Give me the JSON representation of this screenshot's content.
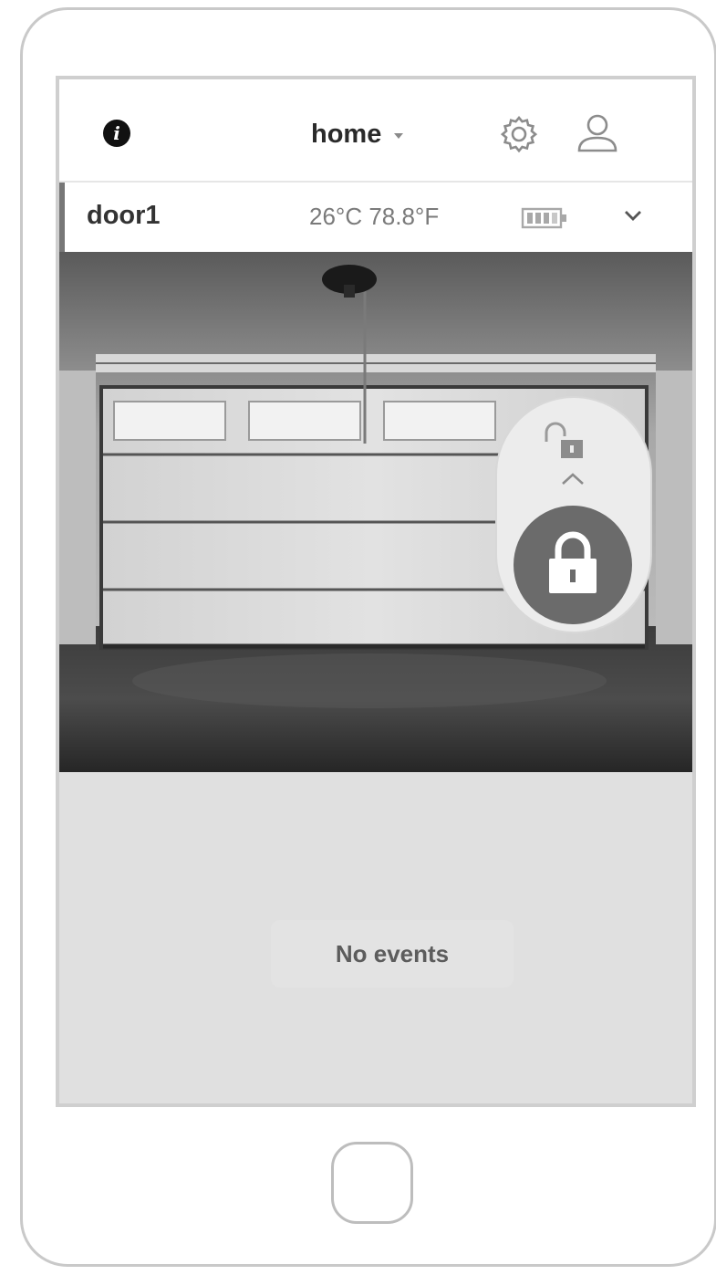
{
  "header": {
    "info_icon": "info-icon",
    "info_glyph": "i",
    "location": "home",
    "settings_icon": "gear-icon",
    "user_icon": "user-icon"
  },
  "device": {
    "name": "door1",
    "temperature": "26°C 78.8°F",
    "battery_icon": "battery-icon",
    "expand_icon": "chevron-down-icon"
  },
  "lock_panel": {
    "unlock_icon": "unlock-icon",
    "swipe_hint_icon": "chevron-up-icon",
    "lock_icon": "lock-icon"
  },
  "events": {
    "empty_label": "No events"
  },
  "colors": {
    "screen_background": "#e0e0e0",
    "lock_button": "#6b6b6b",
    "accent_bar": "#777777"
  }
}
